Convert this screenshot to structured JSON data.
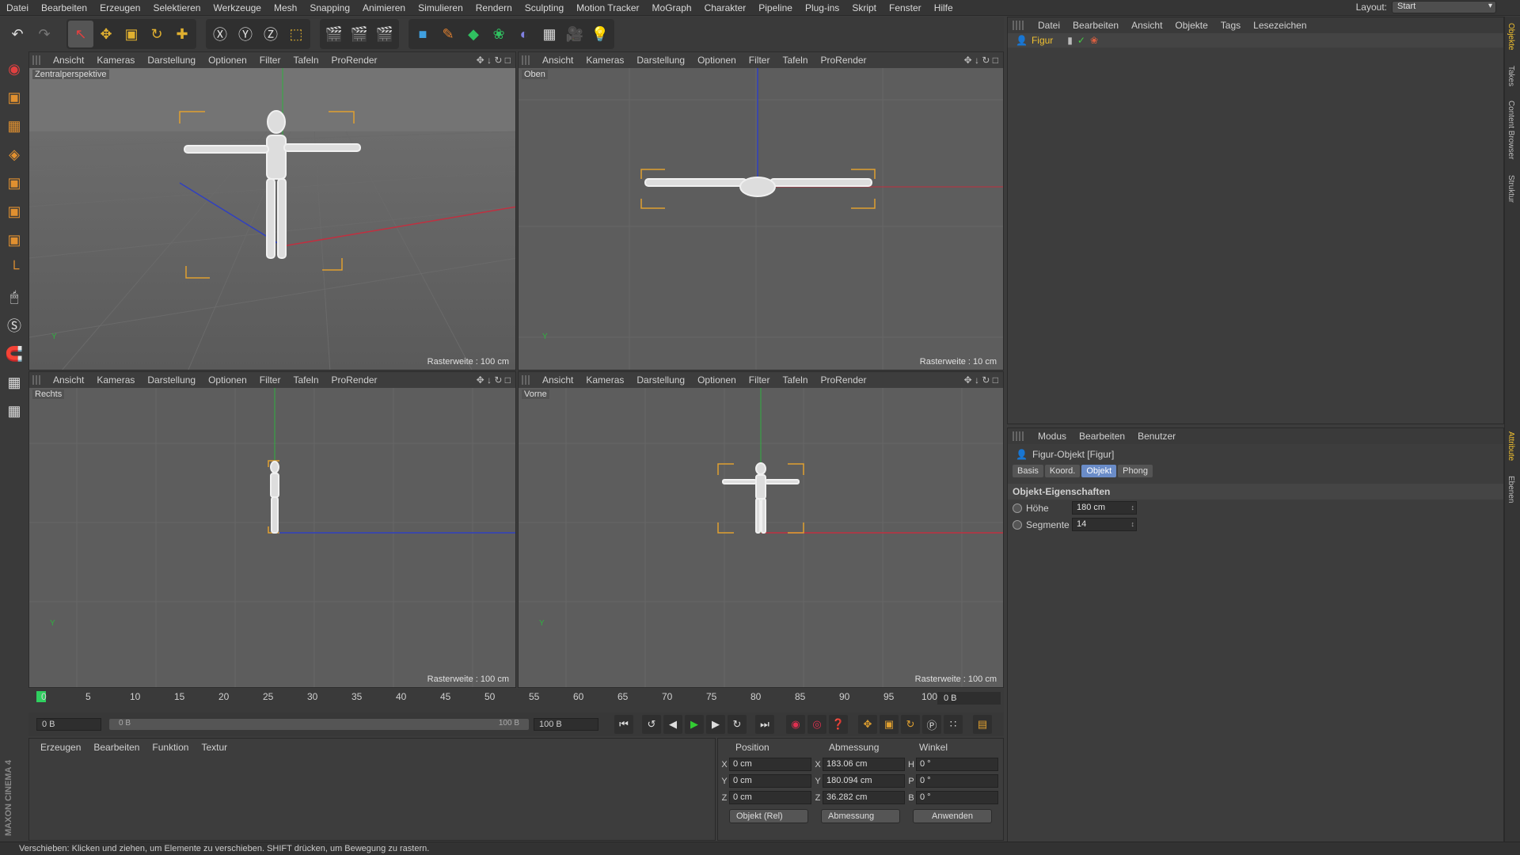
{
  "menu": [
    "Datei",
    "Bearbeiten",
    "Erzeugen",
    "Selektieren",
    "Werkzeuge",
    "Mesh",
    "Snapping",
    "Animieren",
    "Simulieren",
    "Rendern",
    "Sculpting",
    "Motion Tracker",
    "MoGraph",
    "Charakter",
    "Pipeline",
    "Plug-ins",
    "Skript",
    "Fenster",
    "Hilfe"
  ],
  "layout": {
    "label": "Layout:",
    "value": "Start"
  },
  "viewport_menu": [
    "Ansicht",
    "Kameras",
    "Darstellung",
    "Optionen",
    "Filter",
    "Tafeln",
    "ProRender"
  ],
  "viewports": [
    {
      "label": "Zentralperspektive",
      "raster": "Rasterweite : 100 cm"
    },
    {
      "label": "Oben",
      "raster": "Rasterweite : 10 cm"
    },
    {
      "label": "Rechts",
      "raster": "Rasterweite : 100 cm"
    },
    {
      "label": "Vorne",
      "raster": "Rasterweite : 100 cm"
    }
  ],
  "object_manager": {
    "menu": [
      "Datei",
      "Bearbeiten",
      "Ansicht",
      "Objekte",
      "Tags",
      "Lesezeichen"
    ],
    "objects": [
      {
        "name": "Figur"
      }
    ]
  },
  "attributes": {
    "menu": [
      "Modus",
      "Bearbeiten",
      "Benutzer"
    ],
    "title": "Figur-Objekt [Figur]",
    "tabs": [
      "Basis",
      "Koord.",
      "Objekt",
      "Phong"
    ],
    "active_tab": "Objekt",
    "section": "Objekt-Eigenschaften",
    "props": [
      {
        "label": "Höhe",
        "value": "180 cm"
      },
      {
        "label": "Segmente",
        "value": "14"
      }
    ]
  },
  "right_tabs": [
    "Objekte",
    "Takes",
    "Content Browser",
    "Struktur"
  ],
  "right_tabs_lower": [
    "Attribute",
    "Ebenen"
  ],
  "timeline": {
    "ticks": [
      "0",
      "5",
      "10",
      "15",
      "20",
      "25",
      "30",
      "35",
      "40",
      "45",
      "50",
      "55",
      "60",
      "65",
      "70",
      "75",
      "80",
      "85",
      "90",
      "95",
      "100"
    ],
    "current": "0 B",
    "start": "0 B",
    "range_start": "0 B",
    "range_end": "100 B",
    "end": "100 B"
  },
  "material_manager": {
    "menu": [
      "Erzeugen",
      "Bearbeiten",
      "Funktion",
      "Textur"
    ]
  },
  "coordinates": {
    "headers": [
      "Position",
      "Abmessung",
      "Winkel"
    ],
    "rows": [
      {
        "pa": "X",
        "pv": "0 cm",
        "sa": "X",
        "sv": "183.06 cm",
        "ra": "H",
        "rv": "0 °"
      },
      {
        "pa": "Y",
        "pv": "0 cm",
        "sa": "Y",
        "sv": "180.094 cm",
        "ra": "P",
        "rv": "0 °"
      },
      {
        "pa": "Z",
        "pv": "0 cm",
        "sa": "Z",
        "sv": "36.282 cm",
        "ra": "B",
        "rv": "0 °"
      }
    ],
    "mode": "Objekt (Rel)",
    "size_mode": "Abmessung",
    "apply": "Anwenden"
  },
  "status": "Verschieben: Klicken und ziehen, um Elemente zu verschieben. SHIFT drücken, um Bewegung zu rastern.",
  "brand": "MAXON CINEMA 4D",
  "colors": {
    "accent": "#f0c030",
    "selected_tab": "#6a8cc8",
    "x_axis": "#c03040",
    "y_axis": "#30b040",
    "z_axis": "#3040c0"
  }
}
